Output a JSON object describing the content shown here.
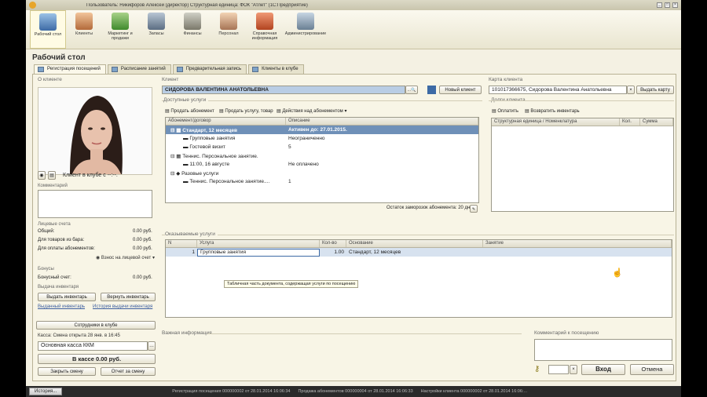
{
  "window": {
    "title": "Пользователь: Никифоров Алексей (директор)   Структурная единица: ФОК \"Атлет\" (1С:Предприятие)"
  },
  "ribbon": [
    {
      "label": "Рабочий стол",
      "icon": "desktop-icon",
      "active": true
    },
    {
      "label": "Клиенты",
      "icon": "clients-icon"
    },
    {
      "label": "Маркетинг и продажи",
      "icon": "marketing-icon"
    },
    {
      "label": "Запасы",
      "icon": "stock-icon"
    },
    {
      "label": "Финансы",
      "icon": "finance-icon"
    },
    {
      "label": "Персонал",
      "icon": "staff-icon"
    },
    {
      "label": "Справочная информация",
      "icon": "reference-icon"
    },
    {
      "label": "Администрирование",
      "icon": "admin-icon"
    }
  ],
  "page_title": "Рабочий стол",
  "tabs": [
    "Регистрация посещений",
    "Расписание занятий",
    "Предварительная запись",
    "Клиенты в клубе"
  ],
  "left": {
    "about_title": "О клиенте",
    "in_club": "Клиент в клубе с --:--.",
    "comment_label": "Комментарий",
    "accounts_title": "Лицевые счета",
    "acc_rows": [
      {
        "label": "Общий:",
        "value": "0.00 руб."
      },
      {
        "label": "Для товаров из бара:",
        "value": "0.00 руб."
      },
      {
        "label": "Для оплаты абонементов:",
        "value": "0.00 руб."
      }
    ],
    "deposit_btn": "Взнос на лицевой счет",
    "bonuses_title": "Бонусы",
    "bonus_label": "Бонусный счет:",
    "bonus_value": "0.00 руб.",
    "inventory_title": "Выдача инвентаря",
    "issue_btn": "Выдать инвентарь",
    "return_btn": "Вернуть инвентарь",
    "issued_link": "Выданный инвентарь",
    "history_link": "История выдачи инвентаря",
    "staff_btn": "Сотрудники в клубе",
    "cash_title": "Касса: Смена открыта 28 янв. в 16:45",
    "cash_value": "Основная касса ККМ",
    "cash_total": "В кассе 0.00 руб.",
    "close_shift": "Закрыть смену",
    "shift_report": "Отчет за смену"
  },
  "client": {
    "label": "Клиент",
    "value": "СИДОРОВА ВАЛЕНТИНА АНАТОЛЬЕВНА",
    "new_btn": "Новый клиент",
    "card_label": "Карта клиента",
    "card_value": "101017366675, Сидорова Валентина Анатольевна",
    "issue_card_btn": "Выдать карту"
  },
  "services": {
    "title": "Доступные услуги",
    "sell_sub": "Продать абонемент",
    "sell_svc": "Продать услугу, товар",
    "actions": "Действия над абонементом",
    "col1": "Абонемент/договор",
    "col2": "Описание",
    "rows": [
      {
        "name": "Стандарт, 12 месяцев",
        "desc": "Активен до: 27.01.2015.",
        "level": 0,
        "sel": true
      },
      {
        "name": "Групповые занятия",
        "desc": "Неограниченно",
        "level": 1
      },
      {
        "name": "Гостевой визит",
        "desc": "5",
        "level": 1
      },
      {
        "name": "Теннис. Персональное занятие.",
        "desc": "",
        "level": 0
      },
      {
        "name": "11:00, 16 августе",
        "desc": "Не оплачено",
        "level": 1
      },
      {
        "name": "Разовые услуги",
        "desc": "",
        "level": 0
      },
      {
        "name": "Теннис. Персональное занятие....",
        "desc": "1",
        "level": 1
      }
    ],
    "freeze_text": "Остаток заморозок абонемента: 20 дн."
  },
  "debts": {
    "title": "Долги клиента",
    "pay_btn": "Оплатить",
    "return_btn": "Возвратить инвентарь",
    "col1": "Структурная единица / Номенклатура",
    "col2": "Кол.",
    "col3": "Сумма"
  },
  "rendered": {
    "title": "Оказываемые услуги",
    "cols": [
      "N",
      "Услуга",
      "Кол-во",
      "Основание",
      "Занятие"
    ],
    "rows": [
      {
        "n": "1",
        "service": "Групповые занятия",
        "qty": "1.00",
        "basis": "Стандарт, 12 месяцев",
        "lesson": ""
      }
    ],
    "tooltip": "Табличная часть документа, содержащая услуги по посещению"
  },
  "bottom": {
    "important": "Важная информация",
    "visit_comment": "Комментарий к посещению",
    "enter_btn": "Вход",
    "cancel_btn": "Отмена"
  },
  "statusbar": {
    "history": "История...",
    "items": [
      "Регистрация посещения 000000002 от 28.01.2014 16:06:34",
      "Продажа абонементов 000000004 от 28.01.2014 16:06:33",
      "Настройки клиента 000000002 от 28.01.2014 16:06:..."
    ]
  },
  "colors": {
    "background": "#f4f1e3",
    "selection": "#6f90b8",
    "accent": "#3d6aa5"
  }
}
